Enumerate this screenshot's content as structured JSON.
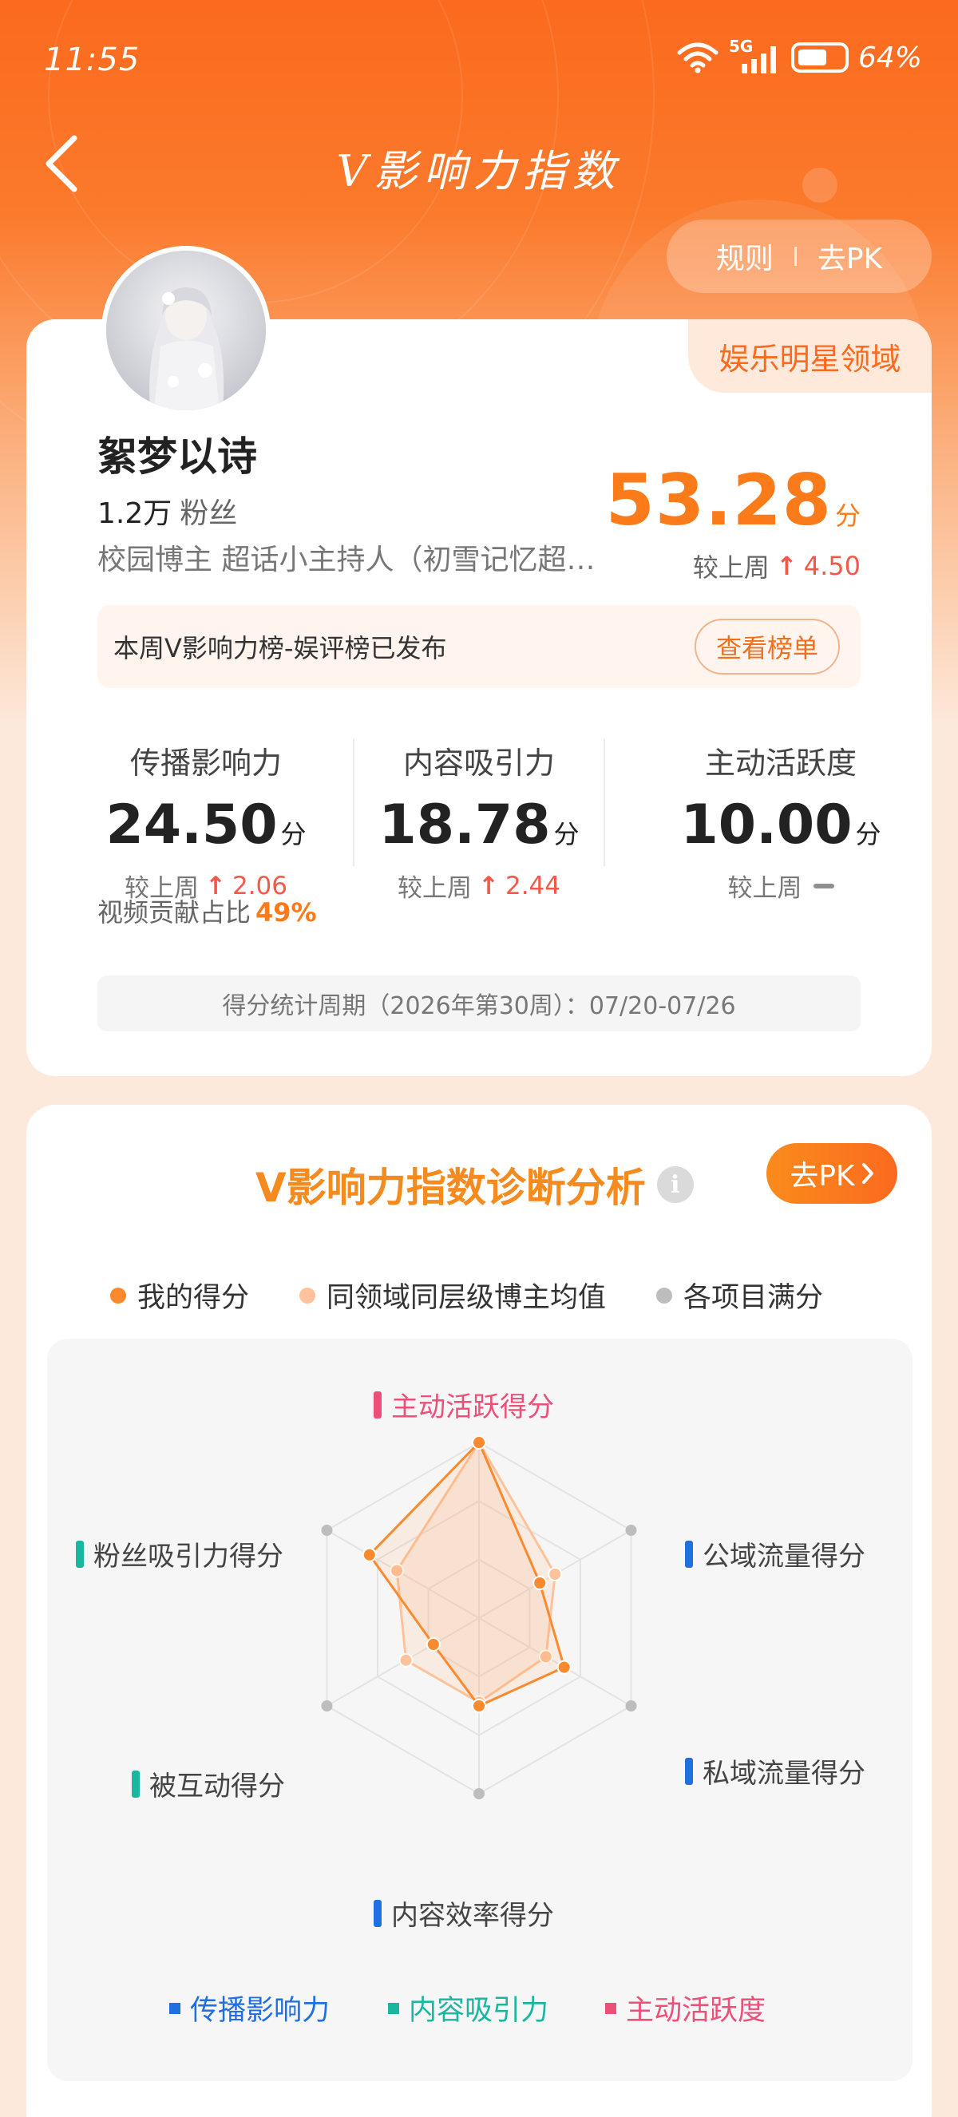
{
  "status_bar": {
    "time": "11:55",
    "network": "5G",
    "battery_pct": "64%",
    "battery_level": 0.64
  },
  "header": {
    "title": "V影响力指数",
    "rules_label": "规则",
    "pk_label": "去PK"
  },
  "profile": {
    "domain_tag": "娱乐明星领域",
    "name": "絮梦以诗",
    "fans_count": "1.2万",
    "fans_label": "粉丝",
    "description": "校园博主 超话小主持人（初雪记忆超话）",
    "total_score": "53.28",
    "score_unit": "分",
    "week_change_label": "较上周",
    "week_change_value": "4.50"
  },
  "notice": {
    "text": "本周V影响力榜-娱评榜已发布",
    "button": "查看榜单"
  },
  "metrics": [
    {
      "label": "传播影响力",
      "value": "24.50",
      "unit": "分",
      "change_label": "较上周",
      "change_value": "2.06",
      "trend": "up"
    },
    {
      "label": "内容吸引力",
      "value": "18.78",
      "unit": "分",
      "change_label": "较上周",
      "change_value": "2.44",
      "trend": "up"
    },
    {
      "label": "主动活跃度",
      "value": "10.00",
      "unit": "分",
      "change_label": "较上周",
      "change_value": "",
      "trend": "flat"
    }
  ],
  "video_ratio": {
    "label": "视频贡献占比",
    "value": "49%"
  },
  "period": {
    "text": "得分统计周期（2026年第30周）：07/20-07/26"
  },
  "analysis": {
    "title": "V影响力指数诊断分析",
    "pk_button": "去PK"
  },
  "chart_data": {
    "type": "radar",
    "legend": [
      {
        "label": "我的得分",
        "color": "#fb8a2e"
      },
      {
        "label": "同领域同层级博主均值",
        "color": "#ffc29a"
      },
      {
        "label": "各项目满分",
        "color": "#bdbdbd"
      }
    ],
    "axes": [
      {
        "label": "主动活跃得分",
        "category": "主动活跃度"
      },
      {
        "label": "公域流量得分",
        "category": "传播影响力"
      },
      {
        "label": "私域流量得分",
        "category": "传播影响力"
      },
      {
        "label": "内容效率得分",
        "category": "内容吸引力"
      },
      {
        "label": "被互动得分",
        "category": "内容吸引力"
      },
      {
        "label": "粉丝吸引力得分",
        "category": "内容吸引力"
      }
    ],
    "series": [
      {
        "name": "我的得分",
        "values": [
          1.0,
          0.4,
          0.56,
          0.5,
          0.3,
          0.72
        ]
      },
      {
        "name": "同领域同层级博主均值",
        "values": [
          1.0,
          0.5,
          0.44,
          0.48,
          0.48,
          0.54
        ]
      },
      {
        "name": "各项目满分",
        "values": [
          1,
          1,
          1,
          1,
          1,
          1
        ]
      }
    ],
    "range": [
      0,
      1
    ],
    "grid_levels": 3,
    "categories": [
      {
        "label": "传播影响力",
        "color": "#1f6fe0"
      },
      {
        "label": "内容吸引力",
        "color": "#1bb6a0"
      },
      {
        "label": "主动活跃度",
        "color": "#ec4f78"
      }
    ]
  }
}
